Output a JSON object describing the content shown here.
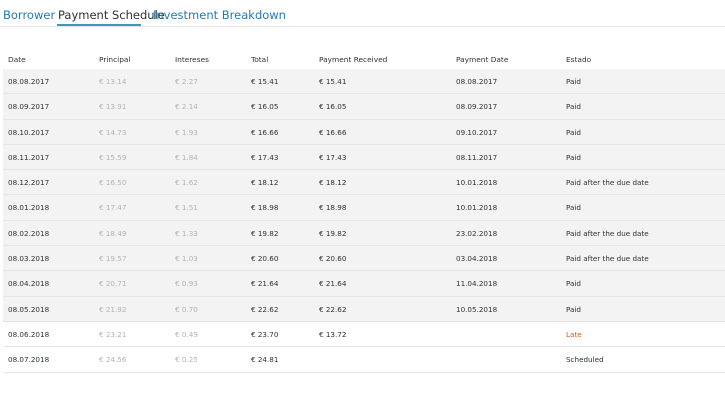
{
  "tabs": [
    {
      "label": "Borrower"
    },
    {
      "label": "Payment Schedule"
    },
    {
      "label": "Investment Breakdown"
    }
  ],
  "table": {
    "headers": {
      "date": "Date",
      "principal": "Principal",
      "intereses": "Intereses",
      "total": "Total",
      "received": "Payment Received",
      "pdate": "Payment Date",
      "estado": "Estado"
    },
    "rows": [
      {
        "date": "08.08.2017",
        "principal": "€ 13.14",
        "intereses": "€ 2.27",
        "total": "€ 15.41",
        "received": "€ 15.41",
        "pdate": "08.08.2017",
        "estado": "Paid"
      },
      {
        "date": "08.09.2017",
        "principal": "€ 13.91",
        "intereses": "€ 2.14",
        "total": "€ 16.05",
        "received": "€ 16.05",
        "pdate": "08.09.2017",
        "estado": "Paid"
      },
      {
        "date": "08.10.2017",
        "principal": "€ 14.73",
        "intereses": "€ 1.93",
        "total": "€ 16.66",
        "received": "€ 16.66",
        "pdate": "09.10.2017",
        "estado": "Paid"
      },
      {
        "date": "08.11.2017",
        "principal": "€ 15.59",
        "intereses": "€ 1.84",
        "total": "€ 17.43",
        "received": "€ 17.43",
        "pdate": "08.11.2017",
        "estado": "Paid"
      },
      {
        "date": "08.12.2017",
        "principal": "€ 16.50",
        "intereses": "€ 1.62",
        "total": "€ 18.12",
        "received": "€ 18.12",
        "pdate": "10.01.2018",
        "estado": "Paid after the due date"
      },
      {
        "date": "08.01.2018",
        "principal": "€ 17.47",
        "intereses": "€ 1.51",
        "total": "€ 18.98",
        "received": "€ 18.98",
        "pdate": "10.01.2018",
        "estado": "Paid"
      },
      {
        "date": "08.02.2018",
        "principal": "€ 18.49",
        "intereses": "€ 1.33",
        "total": "€ 19.82",
        "received": "€ 19.82",
        "pdate": "23.02.2018",
        "estado": "Paid after the due date"
      },
      {
        "date": "08.03.2018",
        "principal": "€ 19.57",
        "intereses": "€ 1.03",
        "total": "€ 20.60",
        "received": "€ 20.60",
        "pdate": "03.04.2018",
        "estado": "Paid after the due date"
      },
      {
        "date": "08.04.2018",
        "principal": "€ 20.71",
        "intereses": "€ 0.93",
        "total": "€ 21.64",
        "received": "€ 21.64",
        "pdate": "11.04.2018",
        "estado": "Paid"
      },
      {
        "date": "08.05.2018",
        "principal": "€ 21.92",
        "intereses": "€ 0.70",
        "total": "€ 22.62",
        "received": "€ 22.62",
        "pdate": "10.05.2018",
        "estado": "Paid"
      },
      {
        "date": "08.06.2018",
        "principal": "€ 23.21",
        "intereses": "€ 0.49",
        "total": "€ 23.70",
        "received": "€ 13.72",
        "pdate": "",
        "estado": "Late"
      },
      {
        "date": "08.07.2018",
        "principal": "€ 24.56",
        "intereses": "€ 0.25",
        "total": "€ 24.81",
        "received": "",
        "pdate": "",
        "estado": "Scheduled"
      }
    ]
  },
  "colors": {
    "accent": "#2479b6",
    "tab_underline": "#3a9ab0",
    "late": "#e2531f",
    "muted": "#b0b4b8",
    "row_shade": "#f3f3f3"
  }
}
